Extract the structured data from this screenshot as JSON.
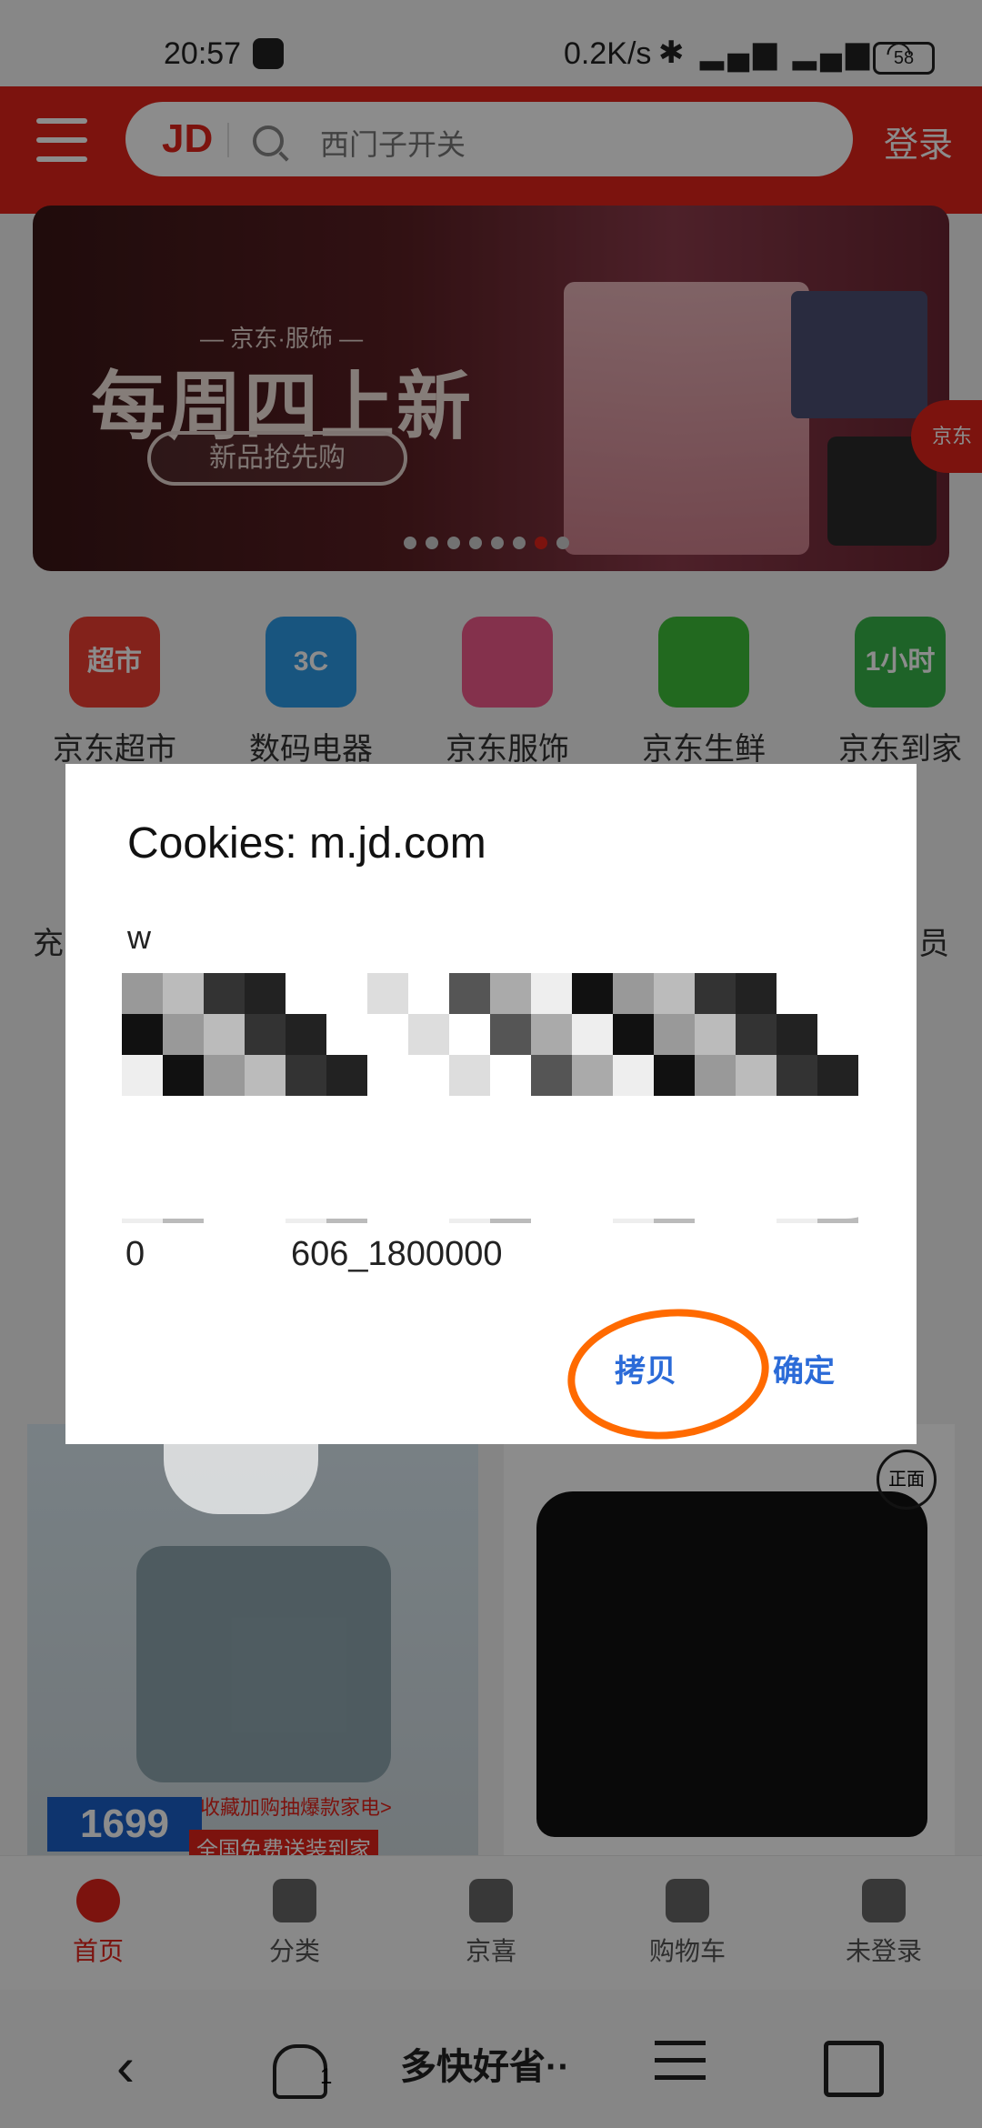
{
  "status_bar": {
    "time": "20:57",
    "network_speed": "0.2K/s",
    "battery": "58"
  },
  "header": {
    "logo": "JD",
    "search_placeholder": "西门子开关",
    "login_label": "登录"
  },
  "banner": {
    "subtitle": "— 京东·服饰 —",
    "title": "每周四上新",
    "button_label": "新品抢先购",
    "page_count": 8,
    "active_page": 7,
    "float_badge": "京东"
  },
  "categories": [
    {
      "label": "京东超市",
      "icon": "supermarket-cart-icon",
      "color": "#ef3e32",
      "badge": "超市"
    },
    {
      "label": "数码电器",
      "icon": "3c-monitor-icon",
      "color": "#2c9be8",
      "badge": "3C"
    },
    {
      "label": "京东服饰",
      "icon": "tshirt-icon",
      "color": "#f05a8b",
      "badge": ""
    },
    {
      "label": "京东生鲜",
      "icon": "fresh-basket-icon",
      "color": "#3fbf3a",
      "badge": ""
    },
    {
      "label": "京东到家",
      "icon": "one-hour-delivery-icon",
      "color": "#38b54a",
      "badge": "1小时"
    }
  ],
  "second_row_partial": {
    "left_label": "充",
    "right_label": "员"
  },
  "dialog": {
    "title": "Cookies: m.jd.com",
    "line_partial_1": "w",
    "line_partial_2": "Ag",
    "line_end": "606_1800000",
    "line_start": "0",
    "copy_label": "拷贝",
    "confirm_label": "确定"
  },
  "products": {
    "card1_price": "1699",
    "card1_caption": "全国免费送装到家",
    "card1_promo": "收藏加购抽爆款家电>",
    "card2_tag": "正面"
  },
  "bottom_nav": [
    {
      "label": "首页",
      "icon": "home-dog-icon",
      "active": true
    },
    {
      "label": "分类",
      "icon": "category-grid-icon",
      "active": false
    },
    {
      "label": "京喜",
      "icon": "jingxi-icon",
      "active": false
    },
    {
      "label": "购物车",
      "icon": "shopping-cart-icon",
      "active": false
    },
    {
      "label": "未登录",
      "icon": "user-icon",
      "active": false
    }
  ],
  "system_nav": {
    "back": "back-icon",
    "ghost_count": "1",
    "title": "多快好省··",
    "menu": "menu-icon",
    "home": "home-icon"
  }
}
